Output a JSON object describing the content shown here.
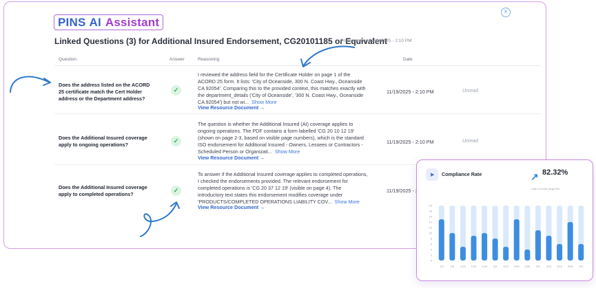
{
  "header": {
    "logo_pins": "PINS",
    "logo_ai": "AI",
    "logo_assistant": "Assistant",
    "close_icon": "close-icon",
    "title": "Linked Questions (3) for Additional Insured Endorsement, CG20101185 or Equivalent",
    "processed": "Processed on 11/19/2025 - 2:10 PM"
  },
  "table": {
    "columns": [
      "Question",
      "Answer",
      "Reasoning",
      "Date"
    ],
    "rows": [
      {
        "question": "Does the address listed on the ACORD 25 certificate match the Cert Holder address or the Department address?",
        "answer_icon": "check-icon",
        "reasoning": "I reviewed the address field for the Certificate Holder on page 1 of the ACORD 25 form. It lists: 'City of Oceanside, 300 N. Coast Hwy., Oceanside CA 92054'. Comparing this to the provided context, this matches exactly with the department_details ('City of Oceanside', '300 N. Coast Hwy., Oceanside CA 92054') but not wi...",
        "show_more": "Show More",
        "view_resource": "View Resource Document  →",
        "date": "11/19/2025 - 2:10 PM",
        "status": "Unread"
      },
      {
        "question": "Does the Additional Insured coverage apply to ongoing operations?",
        "answer_icon": "check-icon",
        "reasoning": "The question is whether the Additional Insured (AI) coverage applies to ongoing operations. The PDF contains a form labelled 'CG 20 10 12 19' (shown on page 2-3, based on visible page numbers), which is the standard ISO endorsement for Additional Insured - Owners, Lessees or Contractors - Scheduled Person or Organizati...",
        "show_more": "Show More",
        "view_resource": "View Resource Document  →",
        "date": "11/19/2025 - 2:10 PM",
        "status": "Unread"
      },
      {
        "question": "Does the Additional Insured coverage apply to completed operations?",
        "answer_icon": "check-icon",
        "reasoning": "To answer if the Additional Insured coverage applies to completed operations, I checked the endorsements provided. The relevant endorsement for completed operations is 'CG 20 37 12 19' (visible on page 4). The introductory text states this endorsement modifies coverage under 'PRODUCTS/COMPLETED OPERATIONS LIABILITY COV...",
        "show_more": "Show More",
        "view_resource": "View Resource Document  →",
        "date": "11/19/2025 - 2:10 PM",
        "status": ""
      }
    ]
  },
  "compliance": {
    "cursor_icon": "cursor-icon",
    "title": "Compliance Rate",
    "trend_icon": "trend-up-icon",
    "value": "82.32%",
    "subtitle": "Last 3 month (avg) info"
  },
  "chart_data": {
    "type": "bar",
    "categories": [
      "1/3",
      "1/8",
      "1/15",
      "1/22",
      "1/29",
      "2/5",
      "2/12",
      "2/19",
      "2/26",
      "3/5",
      "3/12",
      "3/19",
      "3/26",
      "4/2"
    ],
    "values": [
      15,
      10,
      5,
      9,
      10,
      8,
      5,
      15,
      4,
      11,
      9,
      6,
      14,
      6
    ],
    "max_values": [
      20,
      20,
      20,
      20,
      20,
      20,
      20,
      20,
      20,
      20,
      20,
      20,
      20,
      20
    ],
    "yticks": [
      0,
      2,
      4,
      6,
      8,
      10,
      12,
      14,
      16,
      18,
      20
    ],
    "ylim": [
      0,
      20
    ],
    "colors": {
      "bar": "#3d8ee0",
      "track": "#d9e9fb"
    }
  }
}
